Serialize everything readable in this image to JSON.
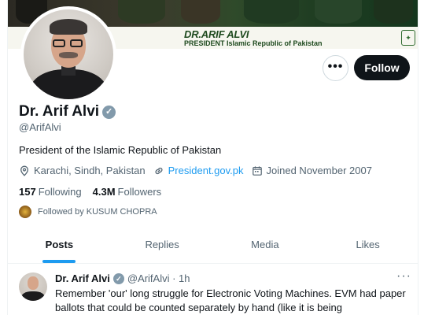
{
  "banner": {
    "title": "DR.ARIF ALVI",
    "subtitle": "PRESIDENT Islamic Republic of Pakistan"
  },
  "actions": {
    "more_label": "•••",
    "follow_label": "Follow"
  },
  "profile": {
    "name": "Dr. Arif Alvi",
    "verified_icon": "verified-badge-icon",
    "handle": "@ArifAlvi",
    "bio": "President of the Islamic Republic of Pakistan",
    "location": "Karachi, Sindh, Pakistan",
    "website": "President.gov.pk",
    "joined": "Joined November 2007",
    "following_count": "157",
    "following_label": "Following",
    "followers_count": "4.3M",
    "followers_label": "Followers",
    "followed_by": "Followed by KUSUM CHOPRA"
  },
  "tabs": [
    {
      "label": "Posts",
      "active": true
    },
    {
      "label": "Replies",
      "active": false
    },
    {
      "label": "Media",
      "active": false
    },
    {
      "label": "Likes",
      "active": false
    }
  ],
  "tweet": {
    "name": "Dr. Arif Alvi",
    "handle_time": "@ArifAlvi · 1h",
    "more": "···",
    "text": "Remember 'our' long struggle for Electronic Voting Machines. EVM had paper ballots that could be counted separately by hand (like it is being"
  },
  "colors": {
    "accent": "#1d9bf0",
    "text_primary": "#0f1419",
    "text_secondary": "#536471",
    "follow_bg": "#0f1419",
    "verified": "#829aab"
  }
}
